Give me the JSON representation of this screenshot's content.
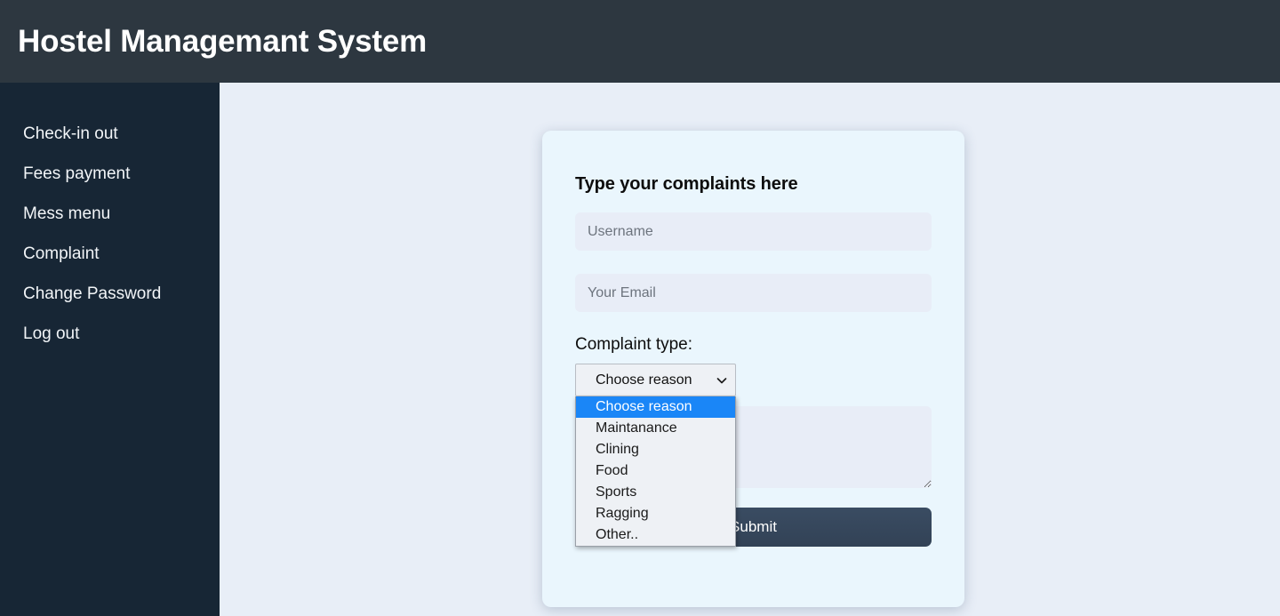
{
  "header": {
    "title": "Hostel Managemant System"
  },
  "sidebar": {
    "items": [
      {
        "label": "Check-in out"
      },
      {
        "label": "Fees payment"
      },
      {
        "label": "Mess menu"
      },
      {
        "label": "Complaint"
      },
      {
        "label": "Change Password"
      },
      {
        "label": "Log out"
      }
    ]
  },
  "card": {
    "heading": "Type your complaints here",
    "username": {
      "value": "",
      "placeholder": "Username"
    },
    "email": {
      "value": "",
      "placeholder": "Your Email"
    },
    "complaint_type_label": "Complaint type:",
    "select": {
      "selected": "Choose reason",
      "expanded": true,
      "highlighted_index": 0,
      "options": [
        "Choose reason",
        "Maintanance",
        "Clining",
        "Food",
        "Sports",
        "Ragging",
        "Other.."
      ]
    },
    "message": {
      "value": "",
      "placeholder": ""
    },
    "submit_label": "Submit"
  },
  "colors": {
    "header_bg": "#2d3740",
    "sidebar_bg": "#172635",
    "page_bg": "#e8eef7",
    "card_bg": "#eaf6fd",
    "input_bg": "#e8edf7",
    "submit_bg": "#38495f",
    "option_highlight": "#1a86f7"
  },
  "icons": {
    "chevron_down": "chevron-down-icon",
    "resize_handle": "resize-handle-icon"
  }
}
